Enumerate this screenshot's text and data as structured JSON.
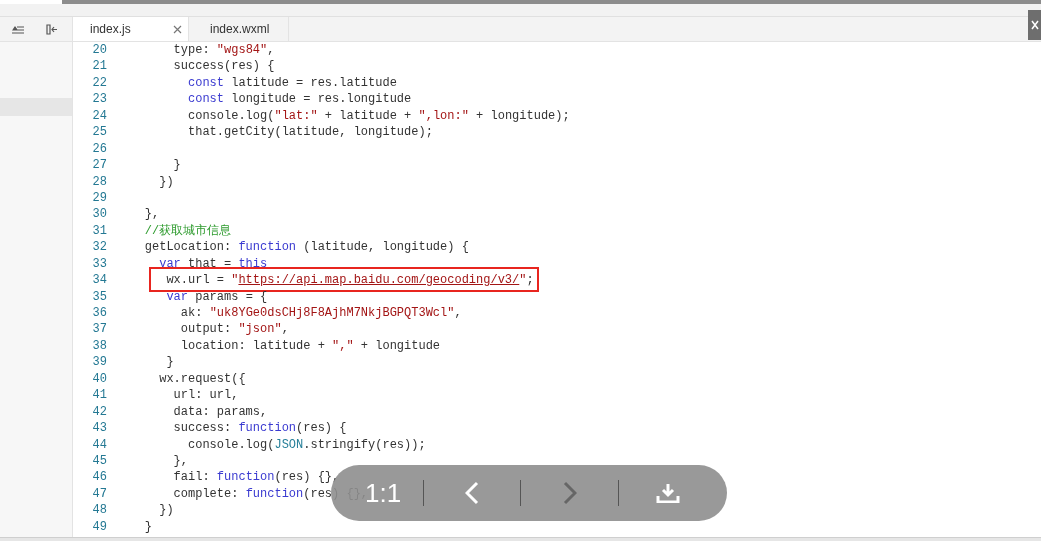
{
  "tabs": [
    {
      "label": "index.js",
      "selected": true,
      "closable": true
    },
    {
      "label": "index.wxml",
      "selected": false,
      "closable": false
    }
  ],
  "editor": {
    "lines": [
      {
        "number": "20",
        "highlighted": false,
        "tokens": [
          {
            "text": "        type: ",
            "kind": "plain"
          },
          {
            "text": "\"wgs84\"",
            "kind": "string"
          },
          {
            "text": ",",
            "kind": "plain"
          }
        ]
      },
      {
        "number": "21",
        "highlighted": false,
        "tokens": [
          {
            "text": "        success(res) {",
            "kind": "plain"
          }
        ]
      },
      {
        "number": "22",
        "highlighted": false,
        "tokens": [
          {
            "text": "          const",
            "kind": "keyword"
          },
          {
            "text": " latitude = res.latitude",
            "kind": "plain"
          }
        ]
      },
      {
        "number": "23",
        "highlighted": false,
        "tokens": [
          {
            "text": "          const",
            "kind": "keyword"
          },
          {
            "text": " longitude = res.longitude",
            "kind": "plain"
          }
        ]
      },
      {
        "number": "24",
        "highlighted": false,
        "tokens": [
          {
            "text": "          console.log(",
            "kind": "plain"
          },
          {
            "text": "\"lat:\"",
            "kind": "string"
          },
          {
            "text": " + latitude + ",
            "kind": "plain"
          },
          {
            "text": "\",lon:\"",
            "kind": "string"
          },
          {
            "text": " + longitude);",
            "kind": "plain"
          }
        ]
      },
      {
        "number": "25",
        "highlighted": false,
        "tokens": [
          {
            "text": "          that.getCity(latitude, longitude);",
            "kind": "plain"
          }
        ]
      },
      {
        "number": "26",
        "highlighted": false
      },
      {
        "number": "27",
        "highlighted": false,
        "tokens": [
          {
            "text": "        }",
            "kind": "plain"
          }
        ]
      },
      {
        "number": "28",
        "highlighted": false,
        "tokens": [
          {
            "text": "      })",
            "kind": "plain"
          }
        ]
      },
      {
        "number": "29",
        "highlighted": false
      },
      {
        "number": "30",
        "highlighted": false,
        "tokens": [
          {
            "text": "    },",
            "kind": "plain"
          }
        ]
      },
      {
        "number": "31",
        "highlighted": false,
        "tokens": [
          {
            "text": "    //获取城市信息",
            "kind": "comment"
          }
        ]
      },
      {
        "number": "32",
        "highlighted": false,
        "tokens": [
          {
            "text": "    getLocation: ",
            "kind": "plain"
          },
          {
            "text": "function",
            "kind": "keyword"
          },
          {
            "text": " (latitude, longitude) {",
            "kind": "plain"
          }
        ]
      },
      {
        "number": "33",
        "highlighted": false,
        "tokens": [
          {
            "text": "      var",
            "kind": "keyword"
          },
          {
            "text": " that = ",
            "kind": "plain"
          },
          {
            "text": "this",
            "kind": "keyword"
          }
        ]
      },
      {
        "number": "34",
        "highlighted": true,
        "tokens": [
          {
            "text": "       wx.url = ",
            "kind": "plain"
          },
          {
            "text": "\"",
            "kind": "string"
          },
          {
            "text": "https://api.map.baidu.com/geocoding/v3/",
            "kind": "link"
          },
          {
            "text": "\"",
            "kind": "string"
          },
          {
            "text": ";",
            "kind": "plain"
          }
        ]
      },
      {
        "number": "35",
        "highlighted": false,
        "tokens": [
          {
            "text": "       var",
            "kind": "keyword"
          },
          {
            "text": " params = {",
            "kind": "plain"
          }
        ]
      },
      {
        "number": "36",
        "highlighted": false,
        "tokens": [
          {
            "text": "         ak: ",
            "kind": "plain"
          },
          {
            "text": "\"uk8YGe0dsCHj8F8AjhM7NkjBGPQT3Wcl\"",
            "kind": "string"
          },
          {
            "text": ",",
            "kind": "plain"
          }
        ]
      },
      {
        "number": "37",
        "highlighted": false,
        "tokens": [
          {
            "text": "         output: ",
            "kind": "plain"
          },
          {
            "text": "\"json\"",
            "kind": "string"
          },
          {
            "text": ",",
            "kind": "plain"
          }
        ]
      },
      {
        "number": "38",
        "highlighted": false,
        "tokens": [
          {
            "text": "         location: latitude + ",
            "kind": "plain"
          },
          {
            "text": "\",\"",
            "kind": "string"
          },
          {
            "text": " + longitude",
            "kind": "plain"
          }
        ]
      },
      {
        "number": "39",
        "highlighted": false,
        "tokens": [
          {
            "text": "       }",
            "kind": "plain"
          }
        ]
      },
      {
        "number": "40",
        "highlighted": false,
        "tokens": [
          {
            "text": "      wx.request({",
            "kind": "plain"
          }
        ]
      },
      {
        "number": "41",
        "highlighted": false,
        "tokens": [
          {
            "text": "        url: url,",
            "kind": "plain"
          }
        ]
      },
      {
        "number": "42",
        "highlighted": false,
        "tokens": [
          {
            "text": "        data: params,",
            "kind": "plain"
          }
        ]
      },
      {
        "number": "43",
        "highlighted": false,
        "tokens": [
          {
            "text": "        success: ",
            "kind": "plain"
          },
          {
            "text": "function",
            "kind": "keyword"
          },
          {
            "text": "(res) {",
            "kind": "plain"
          }
        ]
      },
      {
        "number": "44",
        "highlighted": false,
        "tokens": [
          {
            "text": "          console.log(",
            "kind": "plain"
          },
          {
            "text": "JSON",
            "kind": "type"
          },
          {
            "text": ".stringify(res));",
            "kind": "plain"
          }
        ]
      },
      {
        "number": "45",
        "highlighted": false,
        "tokens": [
          {
            "text": "        },",
            "kind": "plain"
          }
        ]
      },
      {
        "number": "46",
        "highlighted": false,
        "tokens": [
          {
            "text": "        fail: ",
            "kind": "plain"
          },
          {
            "text": "function",
            "kind": "keyword"
          },
          {
            "text": "(res) {},",
            "kind": "plain"
          }
        ]
      },
      {
        "number": "47",
        "highlighted": false,
        "tokens": [
          {
            "text": "        complete: ",
            "kind": "plain"
          },
          {
            "text": "function",
            "kind": "keyword"
          },
          {
            "text": "(res) {},",
            "kind": "plain"
          }
        ]
      },
      {
        "number": "48",
        "highlighted": false,
        "tokens": [
          {
            "text": "      })",
            "kind": "plain"
          }
        ]
      },
      {
        "number": "49",
        "highlighted": false,
        "tokens": [
          {
            "text": "    }",
            "kind": "plain"
          }
        ]
      }
    ]
  },
  "viewer_toolbar": {
    "zoom_label": "1:1",
    "prev_disabled": false,
    "next_disabled": true
  }
}
